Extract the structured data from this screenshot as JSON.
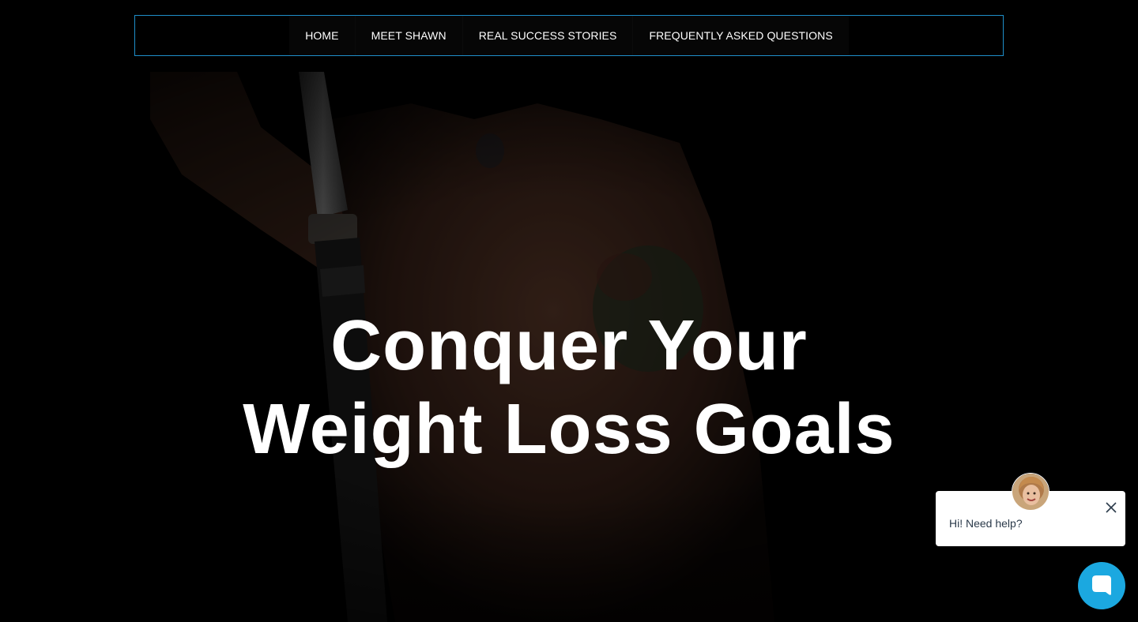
{
  "nav": {
    "items": [
      {
        "label": "HOME"
      },
      {
        "label": "MEET SHAWN"
      },
      {
        "label": "REAL SUCCESS STORIES"
      },
      {
        "label": "FREQUENTLY ASKED QUESTIONS"
      }
    ]
  },
  "hero": {
    "headline_line1": "Conquer Your",
    "headline_line2": "Weight Loss Goals",
    "image_icon": "hero-background-photo"
  },
  "chat": {
    "greeting": "Hi! Need help?",
    "close_icon": "close-icon",
    "launcher_icon": "chat-bubble-icon",
    "accent_color": "#1ba8e0"
  },
  "colors": {
    "nav_border": "#1f8ec9",
    "background": "#000000",
    "text": "#ffffff"
  }
}
